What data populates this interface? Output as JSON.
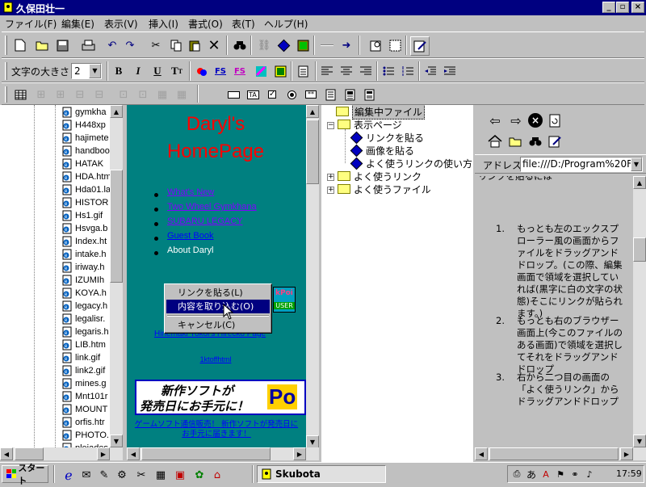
{
  "window": {
    "title": "久保田壮一"
  },
  "menu": [
    "ファイル(F)",
    "編集(E)",
    "表示(V)",
    "挿入(I)",
    "書式(O)",
    "表(T)",
    "ヘルプ(H)"
  ],
  "toolbar2": {
    "font_size_label": "文字の大きさ",
    "font_size_value": "2"
  },
  "files": [
    "gymkha",
    "H448xp",
    "hajimete",
    "handboo",
    "HATAK",
    "HDA.htm",
    "Hda01.la",
    "HISTOR",
    "Hs1.gif",
    "Hsvga.b",
    "Index.ht",
    "intake.h",
    "iriway.h",
    "IZUMIh",
    "KOYA.h",
    "legacy.h",
    "legalisr.",
    "legaris.h",
    "LIB.htm",
    "link.gif",
    "link2.gif",
    "mines.g",
    "Mnt101r",
    "MOUNT",
    "orfis.htr",
    "PHOTO.",
    "pleiades"
  ],
  "web": {
    "title_line1": "Daryl's",
    "title_line2": "HomePage",
    "links": [
      "What's New",
      "Two Wheel Gymkhana",
      "SUBARU LEGACY",
      "Guest Book"
    ],
    "about": "About Daryl",
    "link_under_menu": "Hinemaki Yokoi's Hirecko Page",
    "small_link": "1ktoffhtml",
    "banner_line1": "新作ソフトが",
    "banner_line2": "発売日にお手元に！",
    "banner_badge": "Po",
    "tiny_badge_top": "kPoi",
    "tiny_badge_bottom": "USER",
    "footer_link_1": "ゲームソフト通信販売！ 新作ソフトが発売日に",
    "footer_link_2": "お手元に届きます！"
  },
  "context_menu": [
    "リンクを貼る(L)",
    "内容を取り込む(O)",
    "キャンセル(C)"
  ],
  "tree": {
    "root": "編集中ファイル",
    "display_page": "表示ページ",
    "children": [
      "リンクを貼る",
      "画像を貼る",
      "よく使うリンクの使い方"
    ],
    "favorite_links": "よく使うリンク",
    "favorite_files": "よく使うファイル"
  },
  "browser": {
    "address_label": "アドレス",
    "address_value": "file:///D:/Program%20File"
  },
  "help": {
    "cut_text": "リンクを貼るには",
    "items": [
      "もっとも左のエックスプローラー風の画面からファイルをドラッグアンドドロップ。(この際、編集画面で領域を選択していれば(黒字に白の文字の状態)そこにリンクが貼られます。)",
      "もっとも右のブラウザー画面上(今このファイルのある画面)で領域を選択してそれをドラッグアンドドロップ",
      "右から二つ目の画面の「よく使うリンク」からドラッグアンドドロップ"
    ]
  },
  "taskbar": {
    "start": "スタート",
    "task": "Skubota",
    "time": "17:59"
  }
}
